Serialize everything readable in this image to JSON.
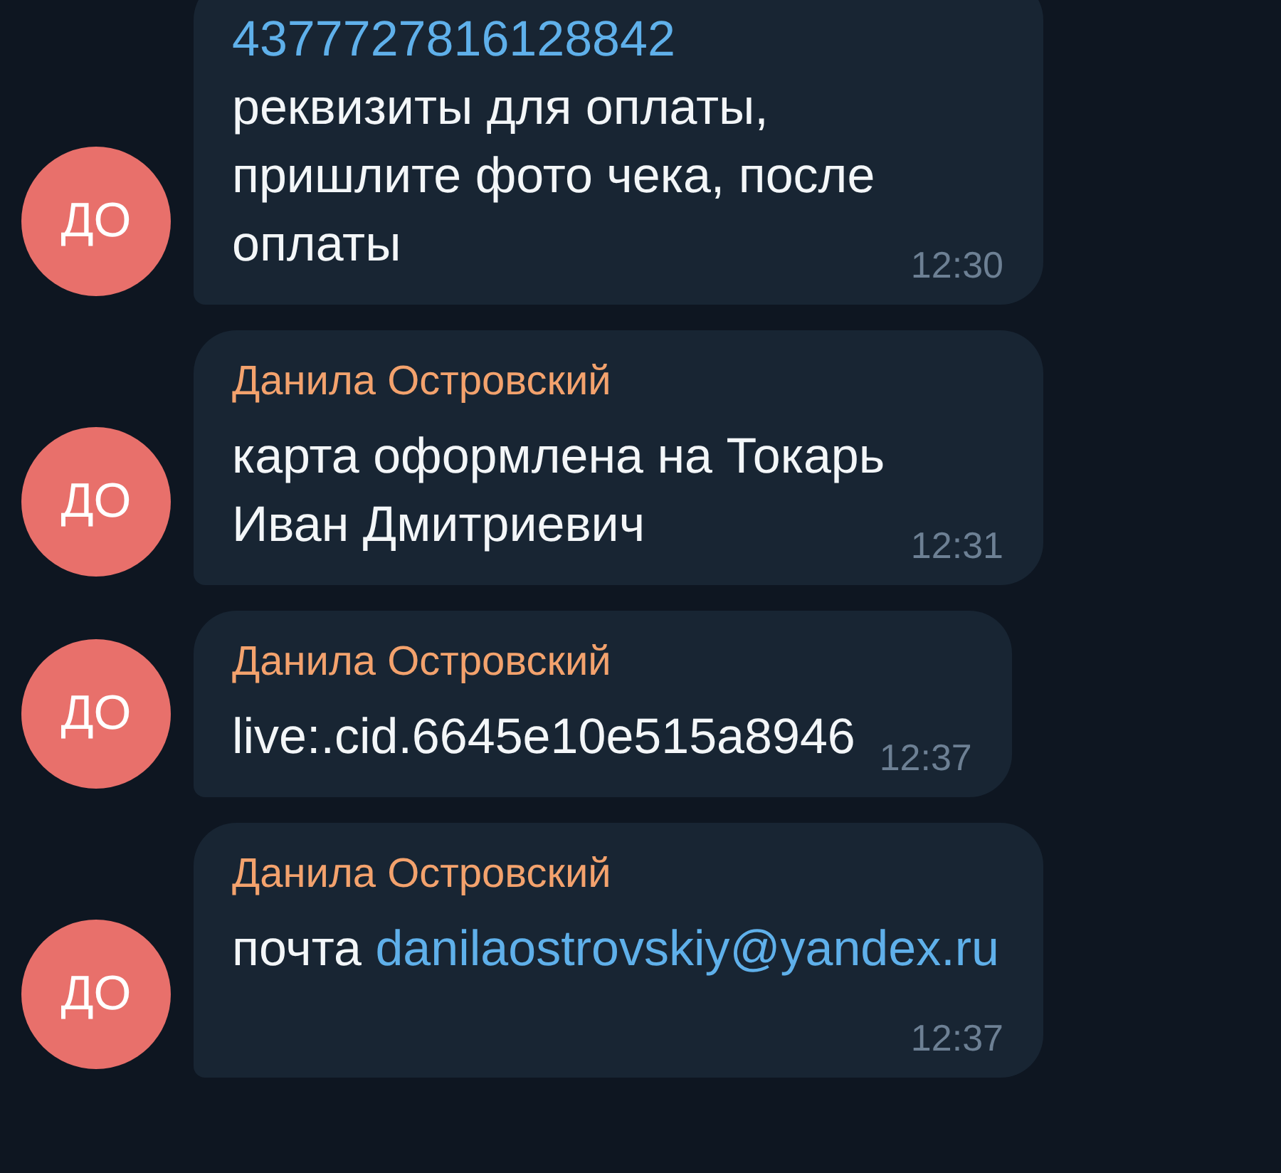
{
  "messages": [
    {
      "avatar": "ДО",
      "segments": [
        {
          "kind": "link",
          "text": "4377727816128842"
        },
        {
          "kind": "break"
        },
        {
          "kind": "text",
          "text": "реквизиты для оплаты, пришлите фото чека, после оплаты"
        }
      ],
      "time": "12:30"
    },
    {
      "avatar": "ДО",
      "sender": "Данила Островский",
      "segments": [
        {
          "kind": "text",
          "text": "карта оформлена на Токарь Иван Дмитриевич"
        }
      ],
      "time": "12:31"
    },
    {
      "avatar": "ДО",
      "sender": "Данила Островский",
      "segments": [
        {
          "kind": "text",
          "text": "live:.cid.6645e10e515a8946"
        }
      ],
      "time": "12:37"
    },
    {
      "avatar": "ДО",
      "sender": "Данила Островский",
      "segments": [
        {
          "kind": "text",
          "text": "почта "
        },
        {
          "kind": "link",
          "text": "danilaostrovskiy@yandex.ru"
        }
      ],
      "time": "12:37"
    }
  ]
}
